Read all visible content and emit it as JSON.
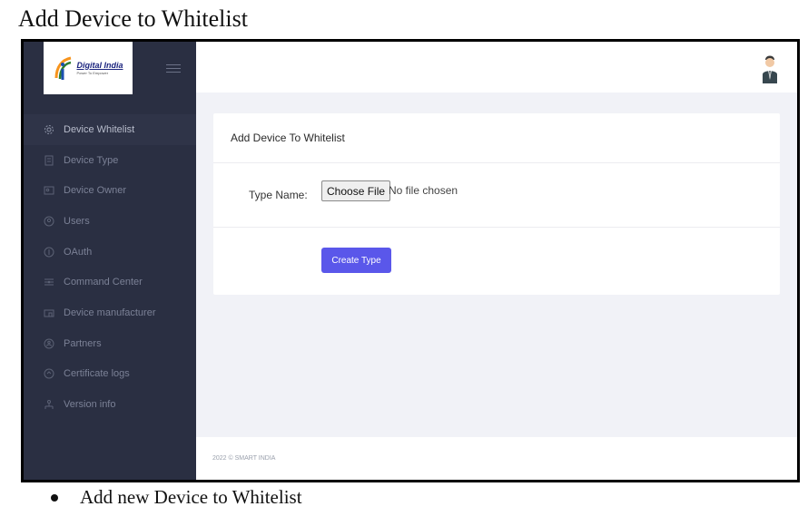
{
  "document": {
    "title": "Add Device to Whitelist",
    "bullet": "Add new Device to Whitelist"
  },
  "brand": {
    "name": "Digital India",
    "tagline": "Power To Empower"
  },
  "sidebar": {
    "items": [
      {
        "label": "Device Whitelist",
        "icon": "gear-icon",
        "active": true
      },
      {
        "label": "Device Type",
        "icon": "document-icon",
        "active": false
      },
      {
        "label": "Device Owner",
        "icon": "id-card-icon",
        "active": false
      },
      {
        "label": "Users",
        "icon": "user-icon",
        "active": false
      },
      {
        "label": "OAuth",
        "icon": "key-icon",
        "active": false
      },
      {
        "label": "Command Center",
        "icon": "command-icon",
        "active": false
      },
      {
        "label": "Device manufacturer",
        "icon": "factory-icon",
        "active": false
      },
      {
        "label": "Partners",
        "icon": "partner-icon",
        "active": false
      },
      {
        "label": "Certificate logs",
        "icon": "certificate-icon",
        "active": false
      },
      {
        "label": "Version info",
        "icon": "info-icon",
        "active": false
      }
    ]
  },
  "card": {
    "title": "Add Device To Whitelist",
    "type_name_label": "Type Name:",
    "file_button": "Choose File",
    "file_status": "No file chosen",
    "submit_label": "Create Type"
  },
  "footer": {
    "text": "2022 © SMART INDIA"
  },
  "colors": {
    "sidebar_bg": "#2a2f42",
    "accent": "#5a57ea",
    "page_bg": "#f1f2f7"
  }
}
